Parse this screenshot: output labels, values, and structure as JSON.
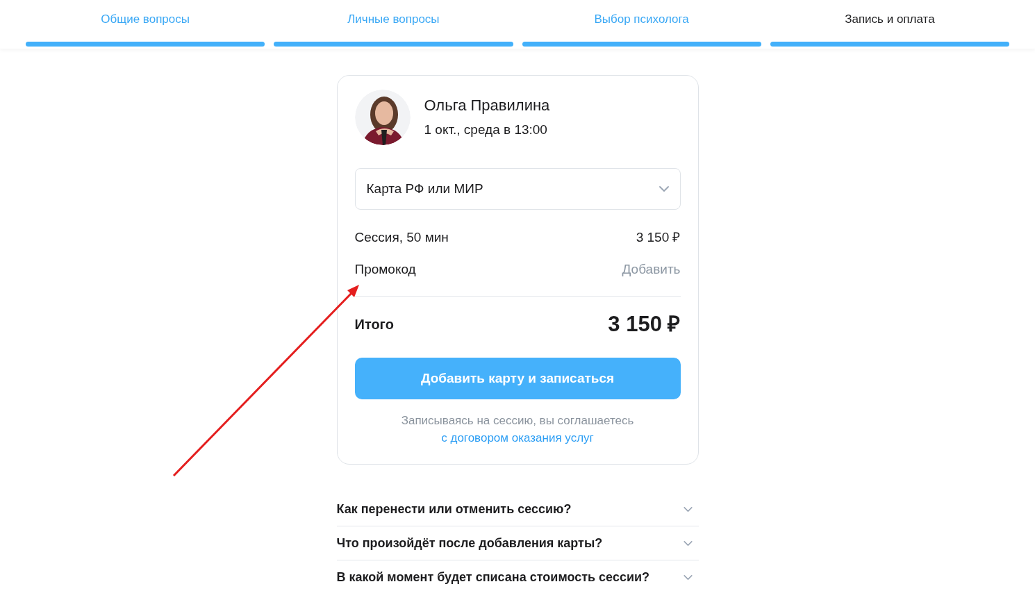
{
  "tabs": [
    {
      "label": "Общие вопросы",
      "selected": false
    },
    {
      "label": "Личные вопросы",
      "selected": false
    },
    {
      "label": "Выбор психолога",
      "selected": false
    },
    {
      "label": "Запись и оплата",
      "selected": true
    }
  ],
  "booking": {
    "psychologist": {
      "name": "Ольга Правилина",
      "datetime": "1 окт., среда в 13:00"
    },
    "payment_method": {
      "value": "Карта РФ или МИР"
    },
    "lines": [
      {
        "kind": "price",
        "label": "Сессия, 50 мин",
        "value": "3 150 ₽"
      },
      {
        "kind": "action",
        "label": "Промокод",
        "value": "Добавить"
      }
    ],
    "total": {
      "label": "Итого",
      "value": "3 150 ₽"
    },
    "submit_button": "Добавить карту и записаться",
    "disclaimer": "Записываясь на сессию, вы соглашаетесь",
    "disclaimer_link": "с договором оказания услуг"
  },
  "faq": [
    {
      "question": "Как перенести или отменить сессию?",
      "expanded": false
    },
    {
      "question": "Что произойдёт после добавления карты?",
      "expanded": false
    },
    {
      "question": "В какой момент будет списана стоимость сессии?",
      "expanded": false
    }
  ]
}
